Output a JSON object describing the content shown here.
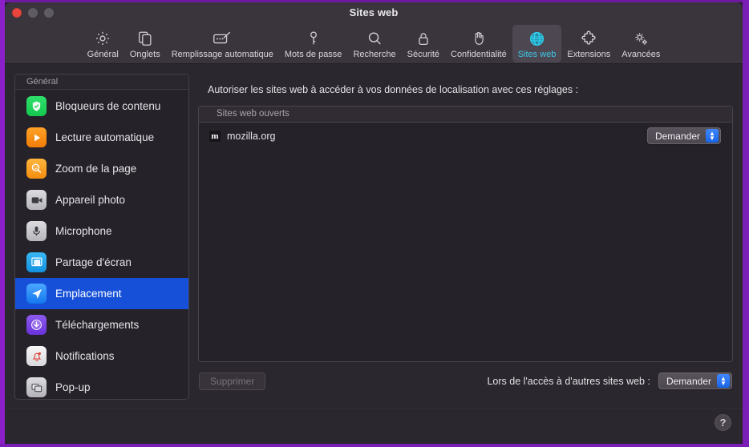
{
  "window": {
    "title": "Sites web",
    "traffic": {
      "close": "close-button",
      "minimize": "minimize-button",
      "zoom": "zoom-button"
    }
  },
  "toolbar": {
    "items": [
      {
        "label": "Général",
        "icon": "gear-icon",
        "active": false
      },
      {
        "label": "Onglets",
        "icon": "tabs-icon",
        "active": false
      },
      {
        "label": "Remplissage automatique",
        "icon": "autofill-icon",
        "active": false
      },
      {
        "label": "Mots de passe",
        "icon": "key-icon",
        "active": false
      },
      {
        "label": "Recherche",
        "icon": "search-icon",
        "active": false
      },
      {
        "label": "Sécurité",
        "icon": "lock-icon",
        "active": false
      },
      {
        "label": "Confidentialité",
        "icon": "hand-icon",
        "active": false
      },
      {
        "label": "Sites web",
        "icon": "globe-icon",
        "active": true
      },
      {
        "label": "Extensions",
        "icon": "puzzle-icon",
        "active": false
      },
      {
        "label": "Avancées",
        "icon": "gears-icon",
        "active": false
      }
    ]
  },
  "sidebar": {
    "header": "Général",
    "items": [
      {
        "label": "Bloqueurs de contenu",
        "icon": "shield-check-icon",
        "selected": false
      },
      {
        "label": "Lecture automatique",
        "icon": "play-icon",
        "selected": false
      },
      {
        "label": "Zoom de la page",
        "icon": "magnifier-icon",
        "selected": false
      },
      {
        "label": "Appareil photo",
        "icon": "camera-icon",
        "selected": false
      },
      {
        "label": "Microphone",
        "icon": "microphone-icon",
        "selected": false
      },
      {
        "label": "Partage d'écran",
        "icon": "screen-share-icon",
        "selected": false
      },
      {
        "label": "Emplacement",
        "icon": "location-arrow-icon",
        "selected": true
      },
      {
        "label": "Téléchargements",
        "icon": "download-icon",
        "selected": false
      },
      {
        "label": "Notifications",
        "icon": "bell-icon",
        "selected": false
      },
      {
        "label": "Pop-up",
        "icon": "popup-windows-icon",
        "selected": false
      }
    ]
  },
  "main": {
    "description": "Autoriser les sites web à accéder à vos données de localisation avec ces réglages :",
    "table": {
      "column_header": "Sites web ouverts",
      "rows": [
        {
          "favicon_letter": "m",
          "site": "mozilla.org",
          "permission": "Demander"
        }
      ]
    },
    "footer": {
      "remove_button": "Supprimer",
      "other_sites_label": "Lors de l'accès à d'autres sites web :",
      "other_sites_value": "Demander"
    }
  },
  "bottom": {
    "help_label": "?"
  },
  "colors": {
    "accent_selected": "#1650d8",
    "accent_tab": "#3ec8e8",
    "popup_chevron": "#1765e8",
    "window_bg": "#2e2a31",
    "desktop_frame": "#8b20c8"
  }
}
